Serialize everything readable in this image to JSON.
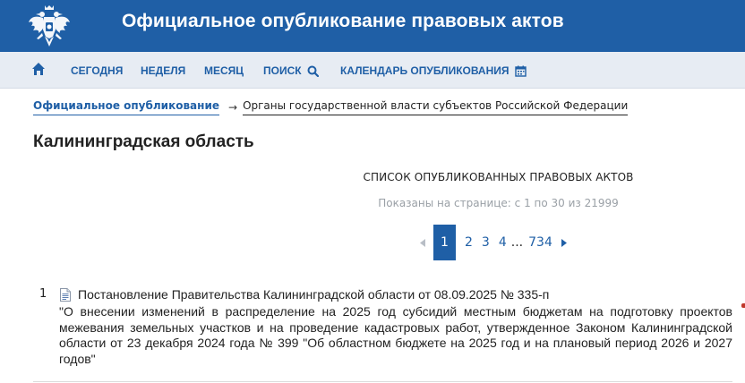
{
  "header": {
    "title": "Официальное опубликование правовых актов",
    "emblem_icon": "coat-of-arms-icon"
  },
  "nav": {
    "home_icon": "home-icon",
    "items": [
      {
        "label": "СЕГОДНЯ"
      },
      {
        "label": "НЕДЕЛЯ"
      },
      {
        "label": "МЕСЯЦ"
      },
      {
        "label": "ПОИСК",
        "icon": "search-icon"
      },
      {
        "label": "КАЛЕНДАРЬ ОПУБЛИКОВАНИЯ",
        "icon": "calendar-icon"
      }
    ]
  },
  "breadcrumb": {
    "root": "Официальное опубликование",
    "separator": "→",
    "current": "Органы государственной власти субъектов Российской Федерации"
  },
  "page": {
    "title": "Калининградская область"
  },
  "list": {
    "heading": "СПИСОК ОПУБЛИКОВАННЫХ ПРАВОВЫХ АКТОВ",
    "count_text": "Показаны на странице: с 1 по 30 из 21999"
  },
  "pagination": {
    "current": "1",
    "pages": [
      "2",
      "3",
      "4"
    ],
    "ellipsis": "...",
    "last": "734"
  },
  "documents": [
    {
      "number": "1",
      "title": "Постановление Правительства Калининградской области от 08.09.2025 № 335-п",
      "description": "\"О внесении изменений в распределение на 2025 год субсидий местным бюджетам на подготовку проектов межевания земельных участков и на проведение кадастровых работ, утвержденное Законом Калининградской области от 23 декабря 2024 года № 399 \"Об областном бюджете на 2025 год и на плановый период 2026 и 2027 годов\""
    }
  ],
  "colors": {
    "brand": "#1f5fa6",
    "nav_background": "#e7ecf3",
    "muted_text": "#9aa0a6"
  }
}
